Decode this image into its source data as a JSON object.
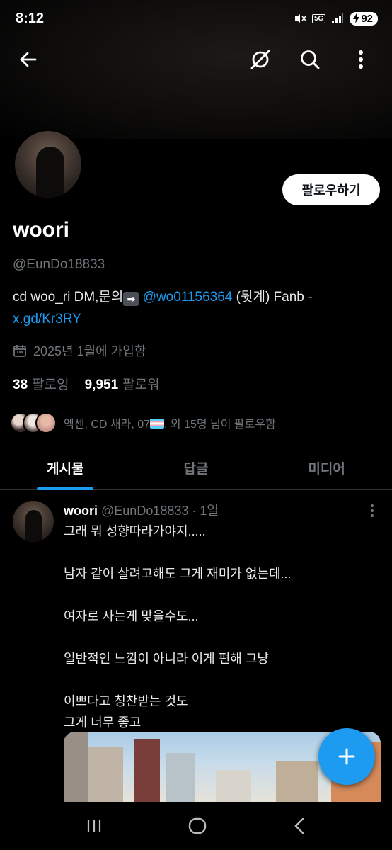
{
  "status": {
    "time": "8:12",
    "network": "5G",
    "battery": "92"
  },
  "profile": {
    "name": "woori",
    "handle": "@EunDo18833",
    "follow_label": "팔로우하기",
    "bio_pre": "cd woo_ri DM,문의",
    "bio_arrow": "➡",
    "bio_mention": "@wo01156364",
    "bio_mid": " (뒷계)  Fanb - ",
    "bio_link": "x.gd/Kr3RY",
    "joined": "2025년 1월에 가입함",
    "following_count": "38",
    "following_label": "팔로잉",
    "followers_count": "9,951",
    "followers_label": "팔로워",
    "known_followers_pre": "엑센, CD 새라, 07",
    "known_followers_post": ", 외 15명 님이 팔로우함"
  },
  "tabs": [
    {
      "label": "게시물"
    },
    {
      "label": "답글"
    },
    {
      "label": "미디어"
    }
  ],
  "post": {
    "author": "woori",
    "handle": "@EunDo18833",
    "time": "· 1일",
    "text": "그래 뭐 성향따라가야지.....\n\n남자 같이 살려고해도 그게 재미가 없는데...\n\n여자로 사는게 맞을수도...\n\n일반적인 느낌이 아니라 이게 편해 그냥\n\n이쁘다고 칭찬받는 것도\n그게 너무 좋고"
  },
  "icons": {
    "back": "arrow-left-icon",
    "grok": "grok-icon",
    "search": "search-icon",
    "more": "more-vertical-icon",
    "calendar": "calendar-icon",
    "compose": "plus-icon"
  },
  "colors": {
    "accent": "#1d9bf0",
    "muted": "#71767b",
    "background": "#000000"
  }
}
